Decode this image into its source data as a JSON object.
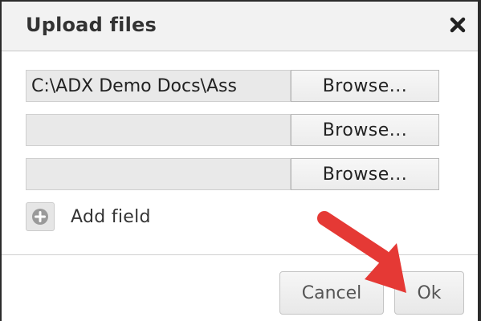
{
  "dialog": {
    "title": "Upload files",
    "close_icon": "close-icon",
    "fields": [
      {
        "value": "C:\\ADX Demo Docs\\Ass",
        "browse_label": "Browse..."
      },
      {
        "value": "",
        "browse_label": "Browse..."
      },
      {
        "value": "",
        "browse_label": "Browse..."
      }
    ],
    "add_field": {
      "icon": "plus-circle-icon",
      "label": "Add field"
    },
    "footer": {
      "cancel_label": "Cancel",
      "ok_label": "Ok"
    }
  },
  "annotation": {
    "icon": "arrow-icon",
    "color": "#e53935"
  },
  "colors": {
    "titlebar": "#f2f2f2",
    "input_background": "#e9e9e9",
    "button_background": "#f0f0f0",
    "text": "#333333"
  }
}
